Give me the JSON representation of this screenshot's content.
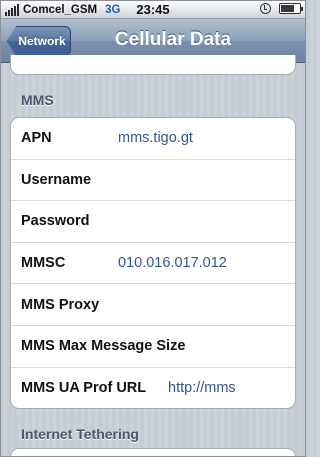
{
  "status_bar": {
    "carrier": "Comcel_GSM",
    "network_type": "3G",
    "time": "23:45"
  },
  "nav": {
    "back_label": "Network",
    "title": "Cellular Data"
  },
  "sections": {
    "mms_header": "MMS",
    "tethering_header": "Internet Tethering"
  },
  "mms_fields": [
    {
      "label": "APN",
      "value": "mms.tigo.gt"
    },
    {
      "label": "Username",
      "value": ""
    },
    {
      "label": "Password",
      "value": ""
    },
    {
      "label": "MMSC",
      "value": "010.016.017.012"
    },
    {
      "label": "MMS Proxy",
      "value": ""
    },
    {
      "label": "MMS Max Message Size",
      "value": ""
    },
    {
      "label": "MMS UA Prof URL",
      "value": "http://mms"
    }
  ],
  "colors": {
    "background": "#c5ccd4",
    "nav_bar": "#6d84a2",
    "value_text": "#36558e",
    "section_header": "#4c566c"
  }
}
